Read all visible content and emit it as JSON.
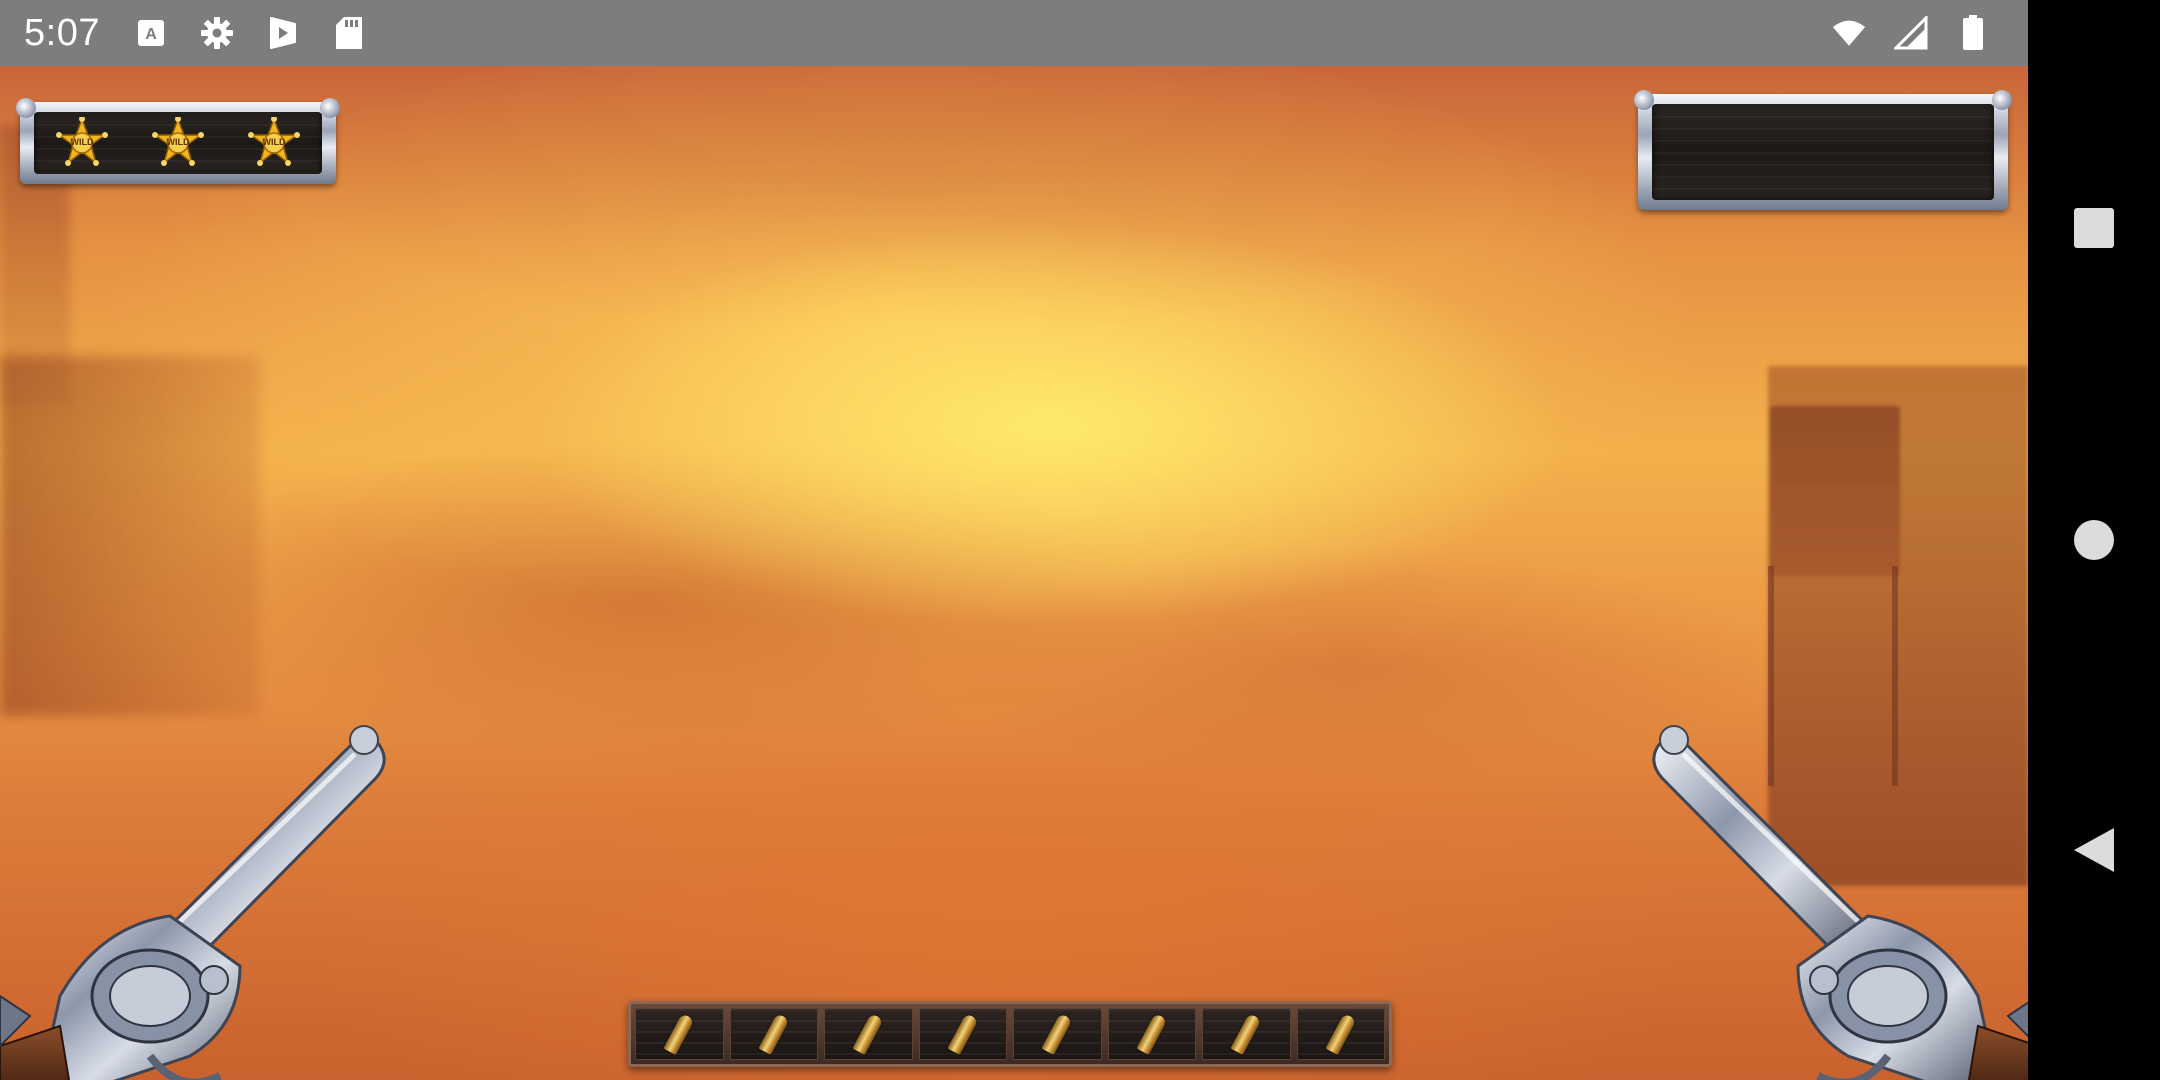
{
  "status_bar": {
    "time": "5:07",
    "left_icons": [
      "keyboard-a-icon",
      "settings-gear-icon",
      "play-store-icon",
      "sd-card-icon"
    ],
    "right_icons": [
      "wifi-icon",
      "cell-signal-icon",
      "battery-icon"
    ],
    "background_color": "#7d7d7d"
  },
  "nav_bar": {
    "buttons": [
      "recents-square-icon",
      "home-circle-icon",
      "back-triangle-icon"
    ],
    "background_color": "#000000"
  },
  "game": {
    "scene": "western-desert-background",
    "badges_panel": {
      "badges": [
        {
          "icon": "sheriff-star-badge-icon",
          "label": "WILD"
        },
        {
          "icon": "sheriff-star-badge-icon",
          "label": "WILD"
        },
        {
          "icon": "sheriff-star-badge-icon",
          "label": "WILD"
        }
      ]
    },
    "score_panel": {
      "value": ""
    },
    "revolvers": [
      "left-revolver",
      "right-revolver"
    ],
    "ammo": {
      "slots": 8,
      "loaded": 8,
      "icon": "bullet-icon"
    },
    "colors": {
      "sky_light": "#fbd75c",
      "sky_orange": "#e59242",
      "metal": "#c5ccd9",
      "wood_dark": "#1d1917",
      "badge_gold": "#f2b51e"
    }
  }
}
